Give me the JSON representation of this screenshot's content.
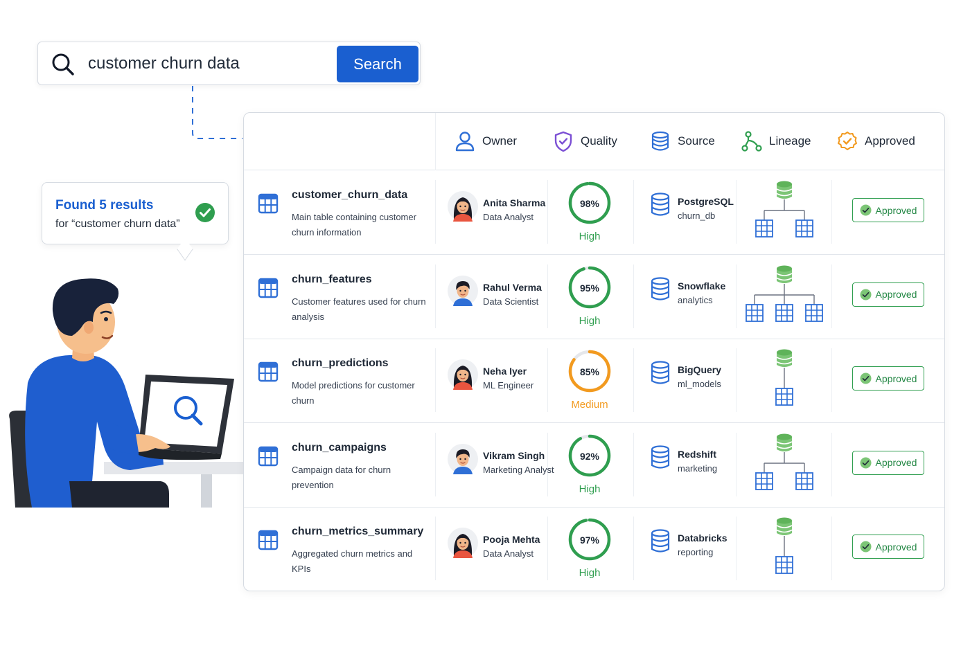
{
  "search": {
    "query": "customer churn data",
    "button_label": "Search"
  },
  "results_bubble": {
    "title": "Found 5 results",
    "subtitle": "for “customer churn data”"
  },
  "table": {
    "headers": {
      "owner": "Owner",
      "quality": "Quality",
      "source": "Source",
      "lineage": "Lineage",
      "approved": "Approved"
    },
    "rows": [
      {
        "name": "customer_churn_data",
        "description": "Main table containing customer churn information",
        "owner_name": "Anita Sharma",
        "owner_role": "Data Analyst",
        "owner_gender": "female",
        "quality_pct": 98,
        "quality_pct_label": "98%",
        "quality_level": "High",
        "quality_color": "#2f9e4f",
        "source_name": "PostgreSQL",
        "source_db": "churn_db",
        "lineage_children": 2,
        "status": "Approved"
      },
      {
        "name": "churn_features",
        "description": "Customer features used for churn analysis",
        "owner_name": "Rahul Verma",
        "owner_role": "Data Scientist",
        "owner_gender": "male",
        "quality_pct": 95,
        "quality_pct_label": "95%",
        "quality_level": "High",
        "quality_color": "#2f9e4f",
        "source_name": "Snowflake",
        "source_db": "analytics",
        "lineage_children": 3,
        "status": "Approved"
      },
      {
        "name": "churn_predictions",
        "description": "Model predictions for customer churn",
        "owner_name": "Neha Iyer",
        "owner_role": "ML Engineer",
        "owner_gender": "female",
        "quality_pct": 85,
        "quality_pct_label": "85%",
        "quality_level": "Medium",
        "quality_color": "#f29a1f",
        "source_name": "BigQuery",
        "source_db": "ml_models",
        "lineage_children": 1,
        "status": "Approved"
      },
      {
        "name": "churn_campaigns",
        "description": "Campaign data for churn prevention",
        "owner_name": "Vikram Singh",
        "owner_role": "Marketing Analyst",
        "owner_gender": "male",
        "quality_pct": 92,
        "quality_pct_label": "92%",
        "quality_level": "High",
        "quality_color": "#2f9e4f",
        "source_name": "Redshift",
        "source_db": "marketing",
        "lineage_children": 2,
        "status": "Approved"
      },
      {
        "name": "churn_metrics_summary",
        "description": "Aggregated churn metrics and KPIs",
        "owner_name": "Pooja Mehta",
        "owner_role": "Data Analyst",
        "owner_gender": "female",
        "quality_pct": 97,
        "quality_pct_label": "97%",
        "quality_level": "High",
        "quality_color": "#2f9e4f",
        "source_name": "Databricks",
        "source_db": "reporting",
        "lineage_children": 1,
        "status": "Approved"
      }
    ]
  },
  "colors": {
    "brand_blue": "#1a5fd0",
    "approved_green": "#2f9e4f",
    "db_green": "#7cc576",
    "table_icon_blue": "#2f6fd6"
  },
  "icons": {
    "search": "search-icon",
    "owner": "user-icon",
    "quality": "shield-check-icon",
    "source": "database-icon",
    "lineage": "lineage-icon",
    "approved": "badge-check-icon"
  }
}
